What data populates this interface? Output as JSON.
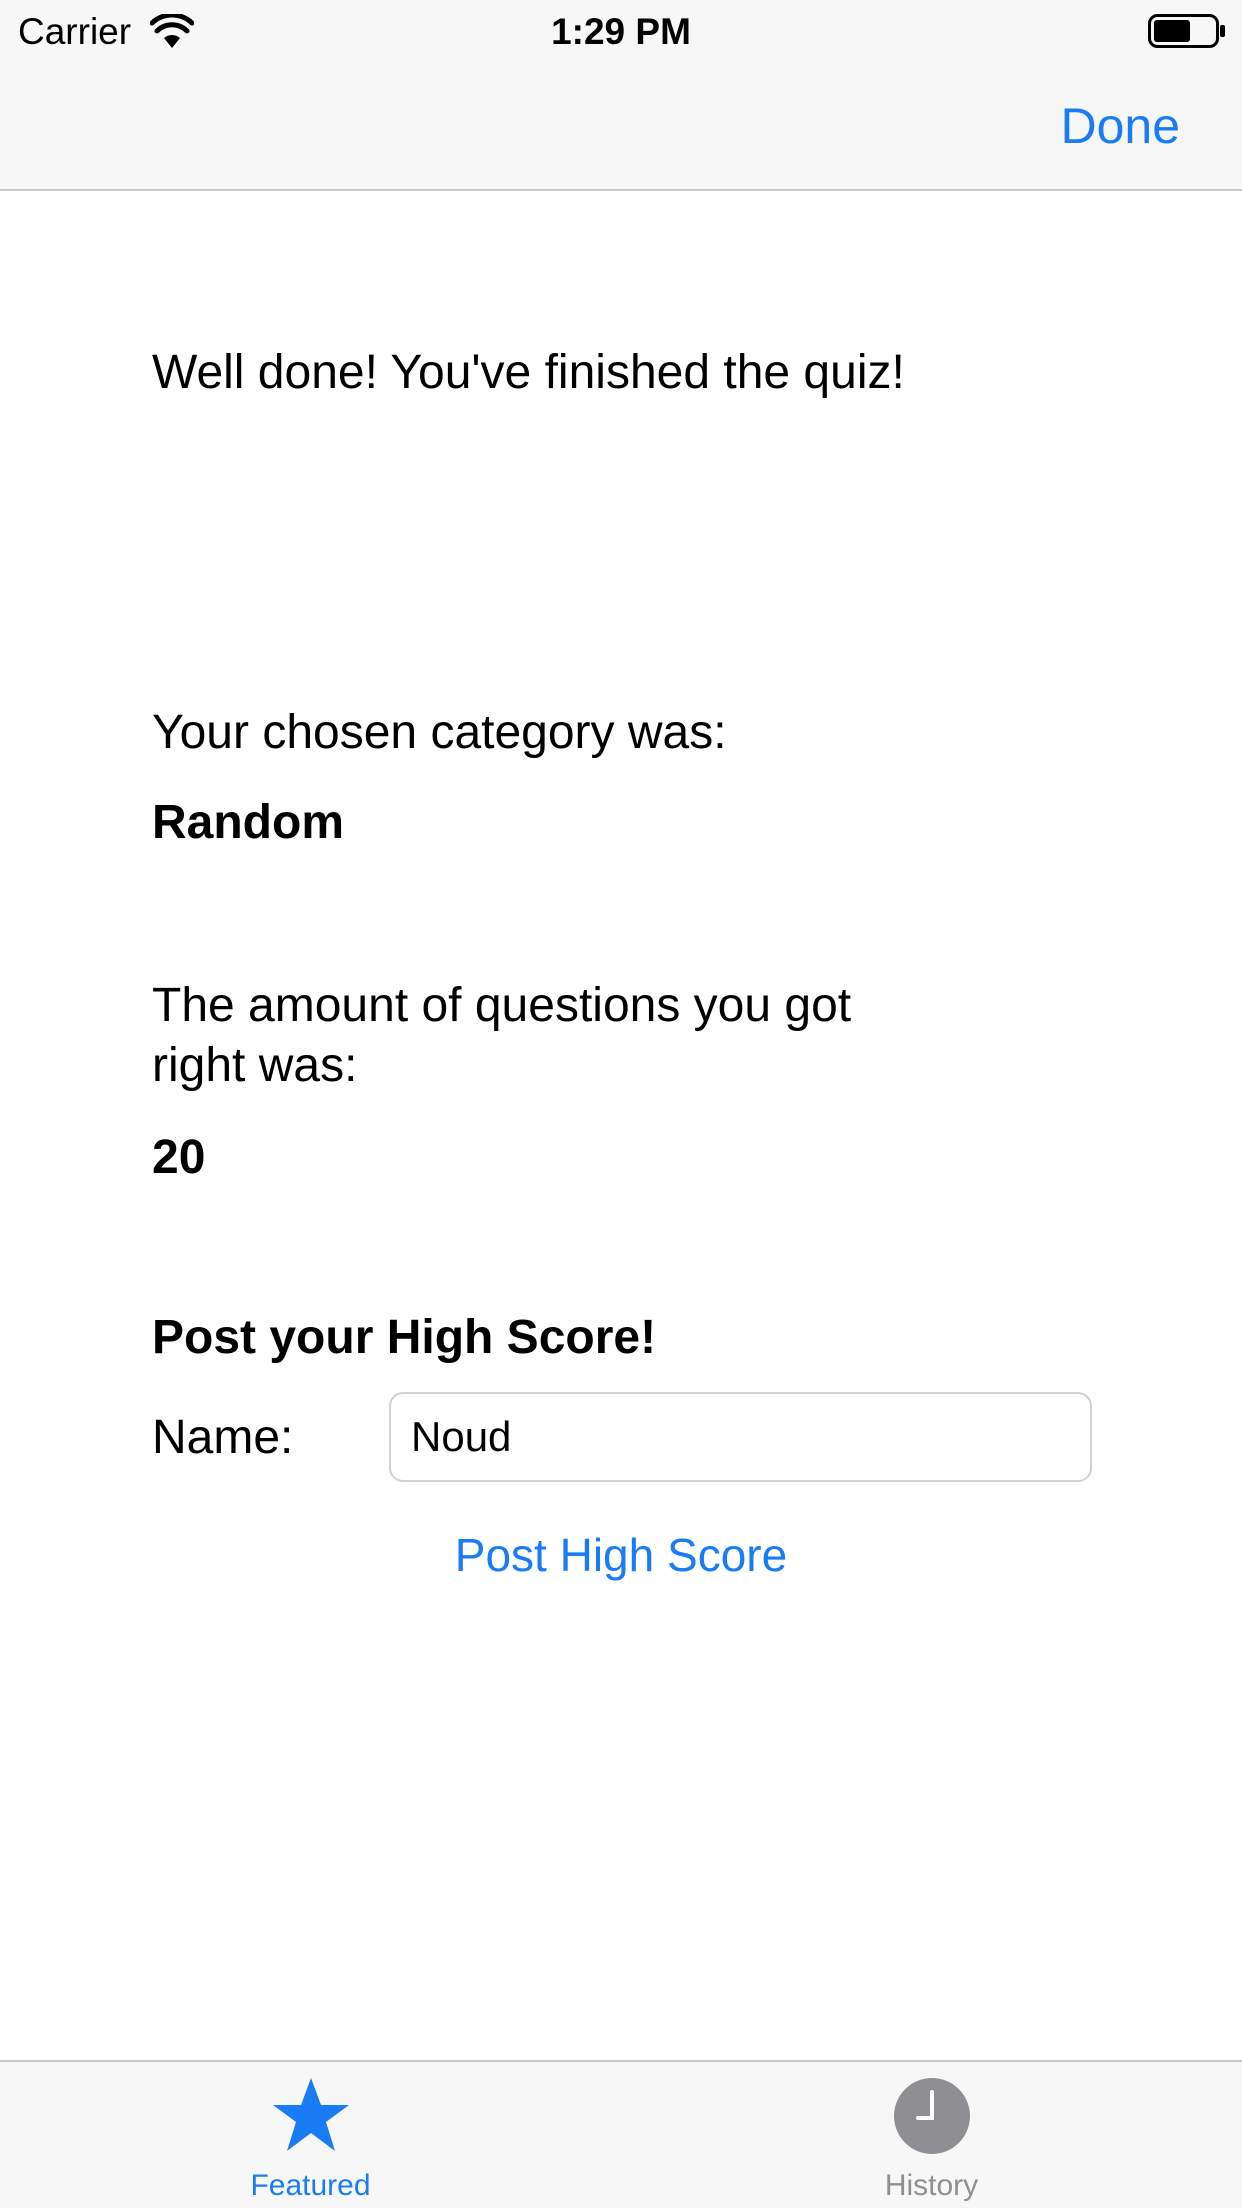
{
  "status_bar": {
    "carrier": "Carrier",
    "time": "1:29 PM"
  },
  "nav": {
    "done_label": "Done"
  },
  "content": {
    "heading": "Well done! You've finished the quiz!",
    "category_label": "Your chosen category was:",
    "category_value": "Random",
    "score_label_line1": "The amount of questions you got",
    "score_label_line2": "right was:",
    "score_value": "20",
    "post_title": "Post your High Score!",
    "name_label": "Name:",
    "name_value": "Noud",
    "post_button_label": "Post High Score"
  },
  "tab_bar": {
    "tabs": [
      {
        "label": "Featured",
        "icon": "star-icon",
        "selected": true
      },
      {
        "label": "History",
        "icon": "clock-icon",
        "selected": false
      }
    ]
  },
  "colors": {
    "accent": "#1a7cf5",
    "inactive": "#8e8e93",
    "bar_background": "#f7f7f7"
  }
}
